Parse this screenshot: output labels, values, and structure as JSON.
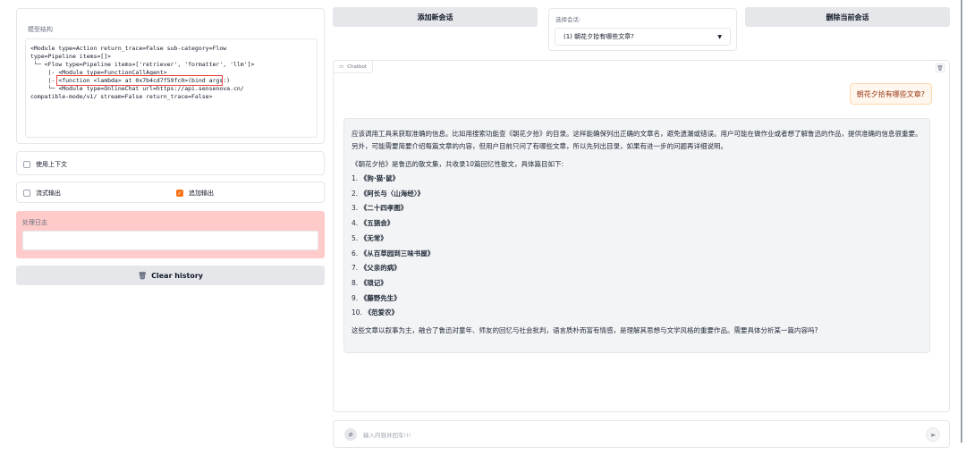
{
  "left": {
    "model_structure": {
      "label": "模型结构",
      "lines": [
        "<Module type=Action return_trace=False sub-category=Flow",
        "type=Pipeline items=[]>",
        " └─ <Flow type=Pipeline items=['retriever', 'formatter', 'llm']>",
        "     |- <Module type=FunctionCallAgent>",
        "     |- <function <lambda> at 0x7b4cd7f59fc0>(bind args:)",
        "     └─ <Module type=OnlineChat url=https://api.sensenova.cn/",
        "compatible-mode/v1/ stream=False return_trace=False>"
      ]
    },
    "use_context": "使用上下文",
    "stream_output": "流式输出",
    "append_output": "追加输出",
    "log_label": "处理日志",
    "clear_history": "Clear history"
  },
  "top": {
    "add_session": "添加新会话",
    "select_label": "选择会话:",
    "selected_session": "(1) 朝花夕拾有哪些文章?",
    "delete_session": "删除当前会话"
  },
  "chat": {
    "label": "Chatbot",
    "user_message": "朝花夕拾有哪些文章?",
    "bot_intro": "应该调用工具来获取准确的信息。比如用搜索功能查《朝花夕拾》的目录。这样能确保列出正确的文章名，避免遗漏或错误。用户可能在做作业或者想了解鲁迅的作品，提供准确的信息很重要。另外，可能需要简要介绍每篇文章的内容，但用户目前只问了有哪些文章，所以先列出目录，如果有进一步的问题再详细说明。",
    "bot_lead": "《朝花夕拾》是鲁迅的散文集，共收录10篇回忆性散文，具体篇目如下:",
    "items": [
      {
        "num": "1.",
        "title": "《狗·猫·鼠》"
      },
      {
        "num": "2.",
        "title": "《阿长与〈山海经〉》"
      },
      {
        "num": "3.",
        "title": "《二十四孝图》"
      },
      {
        "num": "4.",
        "title": "《五猖会》"
      },
      {
        "num": "5.",
        "title": "《无常》"
      },
      {
        "num": "6.",
        "title": "《从百草园到三味书屋》"
      },
      {
        "num": "7.",
        "title": "《父亲的病》"
      },
      {
        "num": "8.",
        "title": "《琐记》"
      },
      {
        "num": "9.",
        "title": "《藤野先生》"
      },
      {
        "num": "10.",
        "title": "《范爱农》"
      }
    ],
    "bot_outro": "这些文章以叙事为主，融合了鲁迅对童年、师友的回忆与社会批判，语言质朴而富有情感，是理解其思想与文学风格的重要作品。需要具体分析某一篇内容吗?",
    "input_placeholder": "输入内容并回车!!!"
  },
  "colors": {
    "accent": "#f97316",
    "highlight_box": "#ef4444",
    "log_bg": "#fecaca",
    "user_bubble": "#fff7ed"
  }
}
